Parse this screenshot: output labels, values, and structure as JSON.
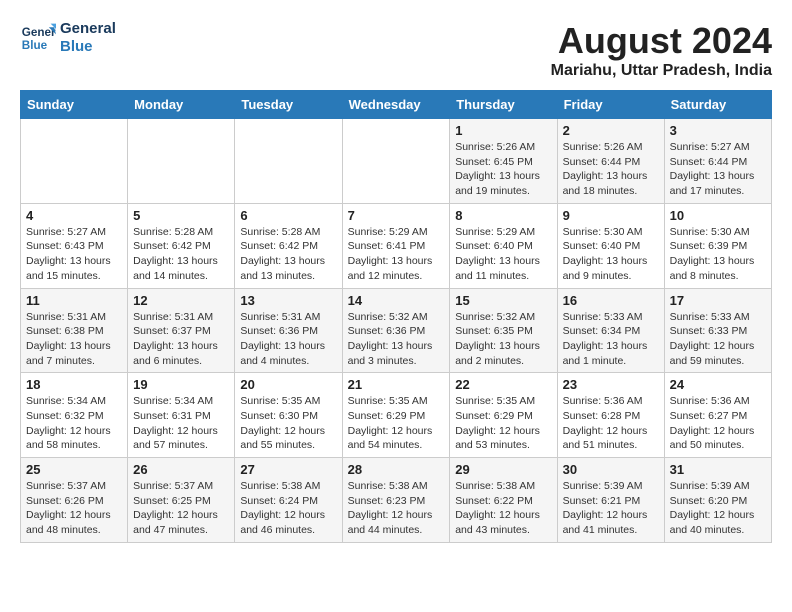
{
  "header": {
    "logo_line1": "General",
    "logo_line2": "Blue",
    "month_year": "August 2024",
    "location": "Mariahu, Uttar Pradesh, India"
  },
  "days_of_week": [
    "Sunday",
    "Monday",
    "Tuesday",
    "Wednesday",
    "Thursday",
    "Friday",
    "Saturday"
  ],
  "weeks": [
    [
      {
        "day": "",
        "info": ""
      },
      {
        "day": "",
        "info": ""
      },
      {
        "day": "",
        "info": ""
      },
      {
        "day": "",
        "info": ""
      },
      {
        "day": "1",
        "info": "Sunrise: 5:26 AM\nSunset: 6:45 PM\nDaylight: 13 hours\nand 19 minutes."
      },
      {
        "day": "2",
        "info": "Sunrise: 5:26 AM\nSunset: 6:44 PM\nDaylight: 13 hours\nand 18 minutes."
      },
      {
        "day": "3",
        "info": "Sunrise: 5:27 AM\nSunset: 6:44 PM\nDaylight: 13 hours\nand 17 minutes."
      }
    ],
    [
      {
        "day": "4",
        "info": "Sunrise: 5:27 AM\nSunset: 6:43 PM\nDaylight: 13 hours\nand 15 minutes."
      },
      {
        "day": "5",
        "info": "Sunrise: 5:28 AM\nSunset: 6:42 PM\nDaylight: 13 hours\nand 14 minutes."
      },
      {
        "day": "6",
        "info": "Sunrise: 5:28 AM\nSunset: 6:42 PM\nDaylight: 13 hours\nand 13 minutes."
      },
      {
        "day": "7",
        "info": "Sunrise: 5:29 AM\nSunset: 6:41 PM\nDaylight: 13 hours\nand 12 minutes."
      },
      {
        "day": "8",
        "info": "Sunrise: 5:29 AM\nSunset: 6:40 PM\nDaylight: 13 hours\nand 11 minutes."
      },
      {
        "day": "9",
        "info": "Sunrise: 5:30 AM\nSunset: 6:40 PM\nDaylight: 13 hours\nand 9 minutes."
      },
      {
        "day": "10",
        "info": "Sunrise: 5:30 AM\nSunset: 6:39 PM\nDaylight: 13 hours\nand 8 minutes."
      }
    ],
    [
      {
        "day": "11",
        "info": "Sunrise: 5:31 AM\nSunset: 6:38 PM\nDaylight: 13 hours\nand 7 minutes."
      },
      {
        "day": "12",
        "info": "Sunrise: 5:31 AM\nSunset: 6:37 PM\nDaylight: 13 hours\nand 6 minutes."
      },
      {
        "day": "13",
        "info": "Sunrise: 5:31 AM\nSunset: 6:36 PM\nDaylight: 13 hours\nand 4 minutes."
      },
      {
        "day": "14",
        "info": "Sunrise: 5:32 AM\nSunset: 6:36 PM\nDaylight: 13 hours\nand 3 minutes."
      },
      {
        "day": "15",
        "info": "Sunrise: 5:32 AM\nSunset: 6:35 PM\nDaylight: 13 hours\nand 2 minutes."
      },
      {
        "day": "16",
        "info": "Sunrise: 5:33 AM\nSunset: 6:34 PM\nDaylight: 13 hours\nand 1 minute."
      },
      {
        "day": "17",
        "info": "Sunrise: 5:33 AM\nSunset: 6:33 PM\nDaylight: 12 hours\nand 59 minutes."
      }
    ],
    [
      {
        "day": "18",
        "info": "Sunrise: 5:34 AM\nSunset: 6:32 PM\nDaylight: 12 hours\nand 58 minutes."
      },
      {
        "day": "19",
        "info": "Sunrise: 5:34 AM\nSunset: 6:31 PM\nDaylight: 12 hours\nand 57 minutes."
      },
      {
        "day": "20",
        "info": "Sunrise: 5:35 AM\nSunset: 6:30 PM\nDaylight: 12 hours\nand 55 minutes."
      },
      {
        "day": "21",
        "info": "Sunrise: 5:35 AM\nSunset: 6:29 PM\nDaylight: 12 hours\nand 54 minutes."
      },
      {
        "day": "22",
        "info": "Sunrise: 5:35 AM\nSunset: 6:29 PM\nDaylight: 12 hours\nand 53 minutes."
      },
      {
        "day": "23",
        "info": "Sunrise: 5:36 AM\nSunset: 6:28 PM\nDaylight: 12 hours\nand 51 minutes."
      },
      {
        "day": "24",
        "info": "Sunrise: 5:36 AM\nSunset: 6:27 PM\nDaylight: 12 hours\nand 50 minutes."
      }
    ],
    [
      {
        "day": "25",
        "info": "Sunrise: 5:37 AM\nSunset: 6:26 PM\nDaylight: 12 hours\nand 48 minutes."
      },
      {
        "day": "26",
        "info": "Sunrise: 5:37 AM\nSunset: 6:25 PM\nDaylight: 12 hours\nand 47 minutes."
      },
      {
        "day": "27",
        "info": "Sunrise: 5:38 AM\nSunset: 6:24 PM\nDaylight: 12 hours\nand 46 minutes."
      },
      {
        "day": "28",
        "info": "Sunrise: 5:38 AM\nSunset: 6:23 PM\nDaylight: 12 hours\nand 44 minutes."
      },
      {
        "day": "29",
        "info": "Sunrise: 5:38 AM\nSunset: 6:22 PM\nDaylight: 12 hours\nand 43 minutes."
      },
      {
        "day": "30",
        "info": "Sunrise: 5:39 AM\nSunset: 6:21 PM\nDaylight: 12 hours\nand 41 minutes."
      },
      {
        "day": "31",
        "info": "Sunrise: 5:39 AM\nSunset: 6:20 PM\nDaylight: 12 hours\nand 40 minutes."
      }
    ]
  ]
}
